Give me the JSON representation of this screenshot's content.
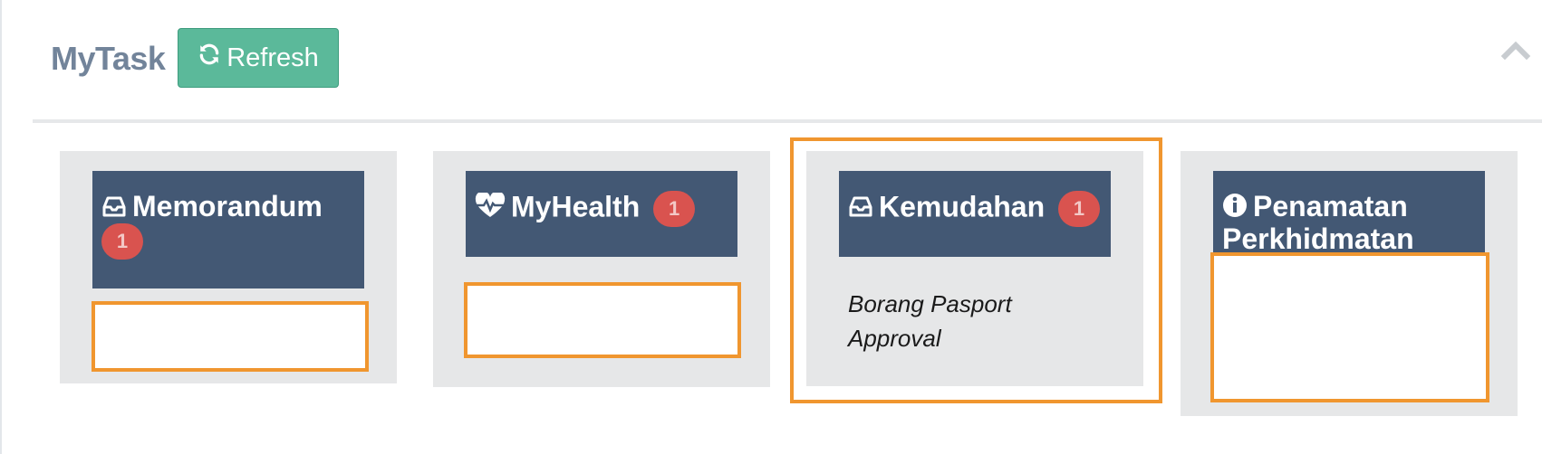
{
  "header": {
    "title": "MyTask",
    "refresh_label": "Refresh"
  },
  "cards": [
    {
      "title": "Memorandum",
      "badge": "1",
      "icon": "inbox-icon"
    },
    {
      "title": "MyHealth",
      "badge": "1",
      "icon": "heartbeat-icon"
    },
    {
      "title": "Kemudahan",
      "badge": "1",
      "icon": "inbox-icon",
      "items": [
        "Borang Pasport",
        "Approval"
      ]
    },
    {
      "title_line1": "Penamatan",
      "title_line2": "Perkhidmatan",
      "icon": "info-circle-icon"
    }
  ],
  "colors": {
    "header_blue": "#435874",
    "badge_red": "#d9534f",
    "refresh_green": "#5bb99a",
    "highlight_orange": "#f0962f",
    "card_gray": "#e6e7e8"
  }
}
